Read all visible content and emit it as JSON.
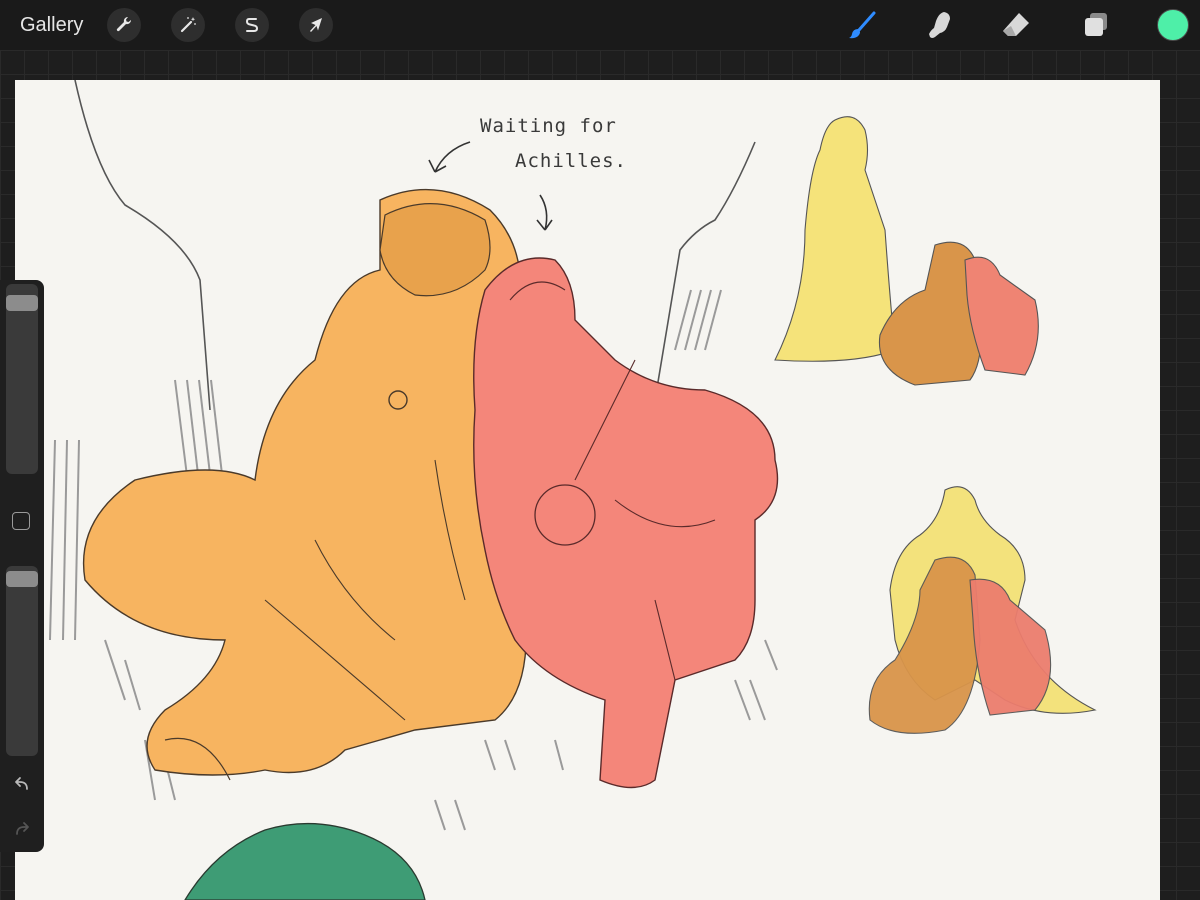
{
  "toolbar": {
    "gallery_label": "Gallery",
    "left_tools": [
      {
        "name": "actions",
        "icon": "wrench-icon"
      },
      {
        "name": "adjustments",
        "icon": "magic-wand-icon"
      },
      {
        "name": "selection",
        "icon": "selection-s-icon"
      },
      {
        "name": "transform",
        "icon": "arrow-cursor-icon"
      }
    ],
    "right_tools": [
      {
        "name": "brush",
        "icon": "brush-icon",
        "active": true
      },
      {
        "name": "smudge",
        "icon": "smudge-finger-icon"
      },
      {
        "name": "eraser",
        "icon": "eraser-icon"
      },
      {
        "name": "layers",
        "icon": "layers-icon"
      }
    ],
    "active_color": "#4eefa8",
    "accent_color": "#2f8cff"
  },
  "canvas": {
    "annotation_line1": "Waiting for",
    "annotation_line2": "Achilles."
  },
  "sidebar": {
    "brush_size_level": 0.95,
    "opacity_level": 0.98,
    "undo_icon": "undo-icon",
    "redo_icon": "redo-icon"
  }
}
